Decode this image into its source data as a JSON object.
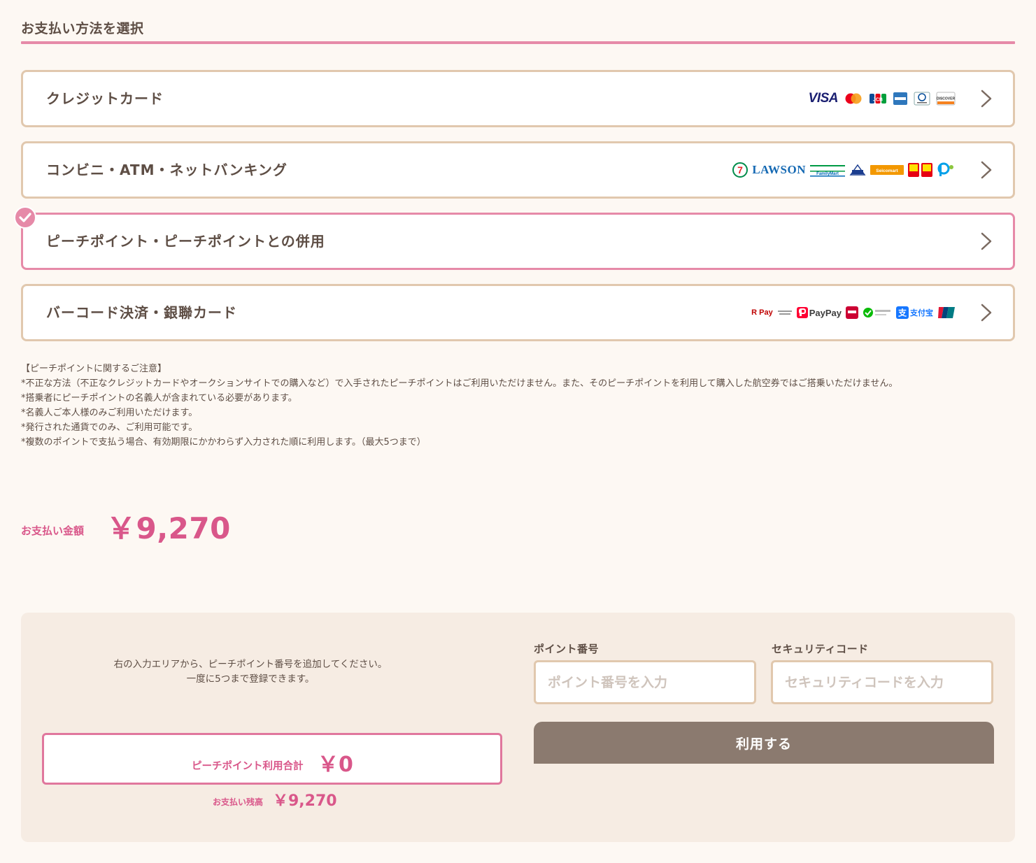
{
  "page": {
    "section_title": "お支払い方法を選択"
  },
  "methods": [
    {
      "label": "クレジットカード",
      "selected": false,
      "logos": [
        "visa-logo",
        "mastercard-logo",
        "jcb-logo",
        "amex-logo",
        "diners-logo",
        "discover-logo"
      ],
      "logo_text": {
        "visa": "VISA",
        "discover": "DISCOVER"
      }
    },
    {
      "label": "コンビニ・ATM・ネットバンキング",
      "selected": false,
      "logos": [
        "seven-eleven-logo",
        "lawson-logo",
        "familymart-logo",
        "ministop-logo",
        "seicomart-logo",
        "daily-yamazaki-logo",
        "pay-easy-logo"
      ],
      "logo_text": {
        "lawson": "LAWSON",
        "familymart": "FamilyMart",
        "seicomart": "Seicomart"
      }
    },
    {
      "label": "ピーチポイント・ピーチポイントとの併用",
      "selected": true,
      "logos": []
    },
    {
      "label": "バーコード決済・銀聯カード",
      "selected": false,
      "logos": [
        "rakuten-pay-logo",
        "paypay-logo",
        "d-barai-logo",
        "wechat-pay-logo",
        "alipay-logo",
        "unionpay-logo"
      ],
      "logo_text": {
        "rpay": "R Pay",
        "paypay": "PayPay",
        "alipay": "支付宝"
      }
    }
  ],
  "notes": [
    "【ピーチポイントに関するご注意】",
    "*不正な方法（不正なクレジットカードやオークションサイトでの購入など）で入手されたピーチポイントはご利用いただけません。また、そのピーチポイントを利用して購入した航空券ではご搭乗いただけません。",
    "*搭乗者にピーチポイントの名義人が含まれている必要があります。",
    "*名義人ご本人様のみご利用いただけます。",
    "*発行された通貨でのみ、ご利用可能です。",
    "*複数のポイントで支払う場合、有効期限にかかわらず入力された順に利用します。（最大5つまで）"
  ],
  "payment": {
    "total_label": "お支払い金額",
    "total_value": "￥9,270"
  },
  "points_panel": {
    "help_line1": "右の入力エリアから、ピーチポイント番号を追加してください。",
    "help_line2": "一度に5つまで登録できます。",
    "sum_label": "ピーチポイント利用合計",
    "sum_value": "￥0",
    "remain_label": "お支払い残高",
    "remain_value": "￥9,270",
    "point_number_label": "ポイント番号",
    "point_number_placeholder": "ポイント番号を入力",
    "security_code_label": "セキュリティコード",
    "security_code_placeholder": "セキュリティコードを入力",
    "use_button_label": "利用する"
  },
  "colors": {
    "accent_pink": "#e68aa8",
    "text_pink": "#d9578a",
    "border_beige": "#e1c8ae",
    "button_brown": "#8b7a6f",
    "background": "#fdf8f3"
  }
}
